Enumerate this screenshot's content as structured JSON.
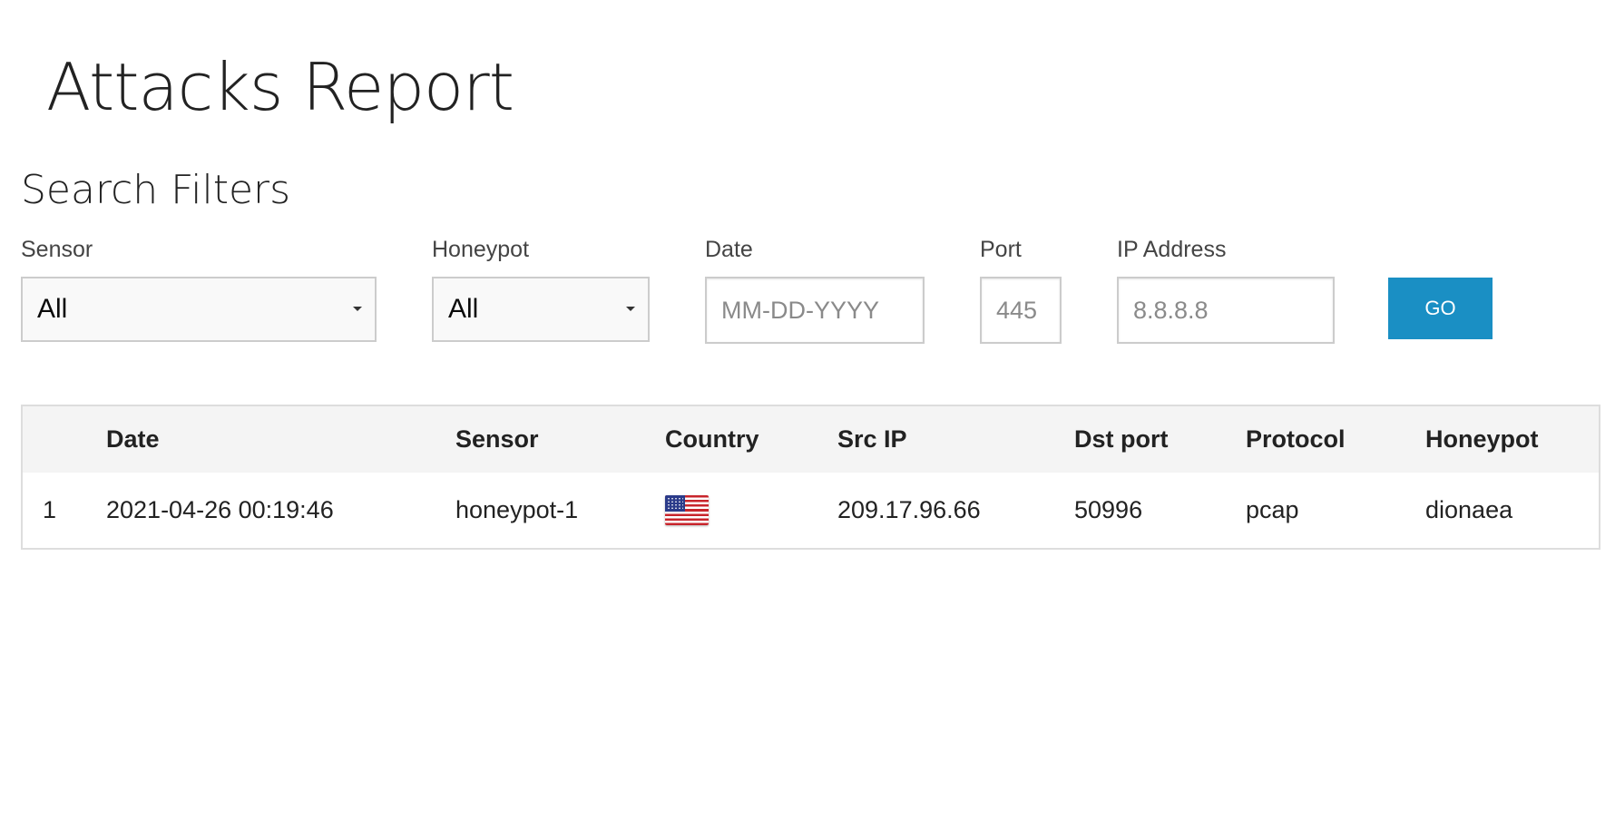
{
  "page": {
    "title": "Attacks Report"
  },
  "filters": {
    "heading": "Search Filters",
    "sensor": {
      "label": "Sensor",
      "value": "All"
    },
    "honeypot": {
      "label": "Honeypot",
      "value": "All"
    },
    "date": {
      "label": "Date",
      "value": "",
      "placeholder": "MM-DD-YYYY"
    },
    "port": {
      "label": "Port",
      "value": "",
      "placeholder": "445"
    },
    "ip": {
      "label": "IP Address",
      "value": "",
      "placeholder": "8.8.8.8"
    },
    "go_label": "GO"
  },
  "table": {
    "headers": [
      "",
      "Date",
      "Sensor",
      "Country",
      "Src IP",
      "Dst port",
      "Protocol",
      "Honeypot"
    ],
    "rows": [
      {
        "index": "1",
        "date": "2021-04-26 00:19:46",
        "sensor": "honeypot-1",
        "country_icon": "us-flag-icon",
        "src_ip": "209.17.96.66",
        "dst_port": "50996",
        "protocol": "pcap",
        "honeypot": "dionaea"
      }
    ]
  },
  "colors": {
    "go_button": "#1a8fc4",
    "table_header_bg": "#f4f4f4",
    "border": "#cccccc"
  }
}
